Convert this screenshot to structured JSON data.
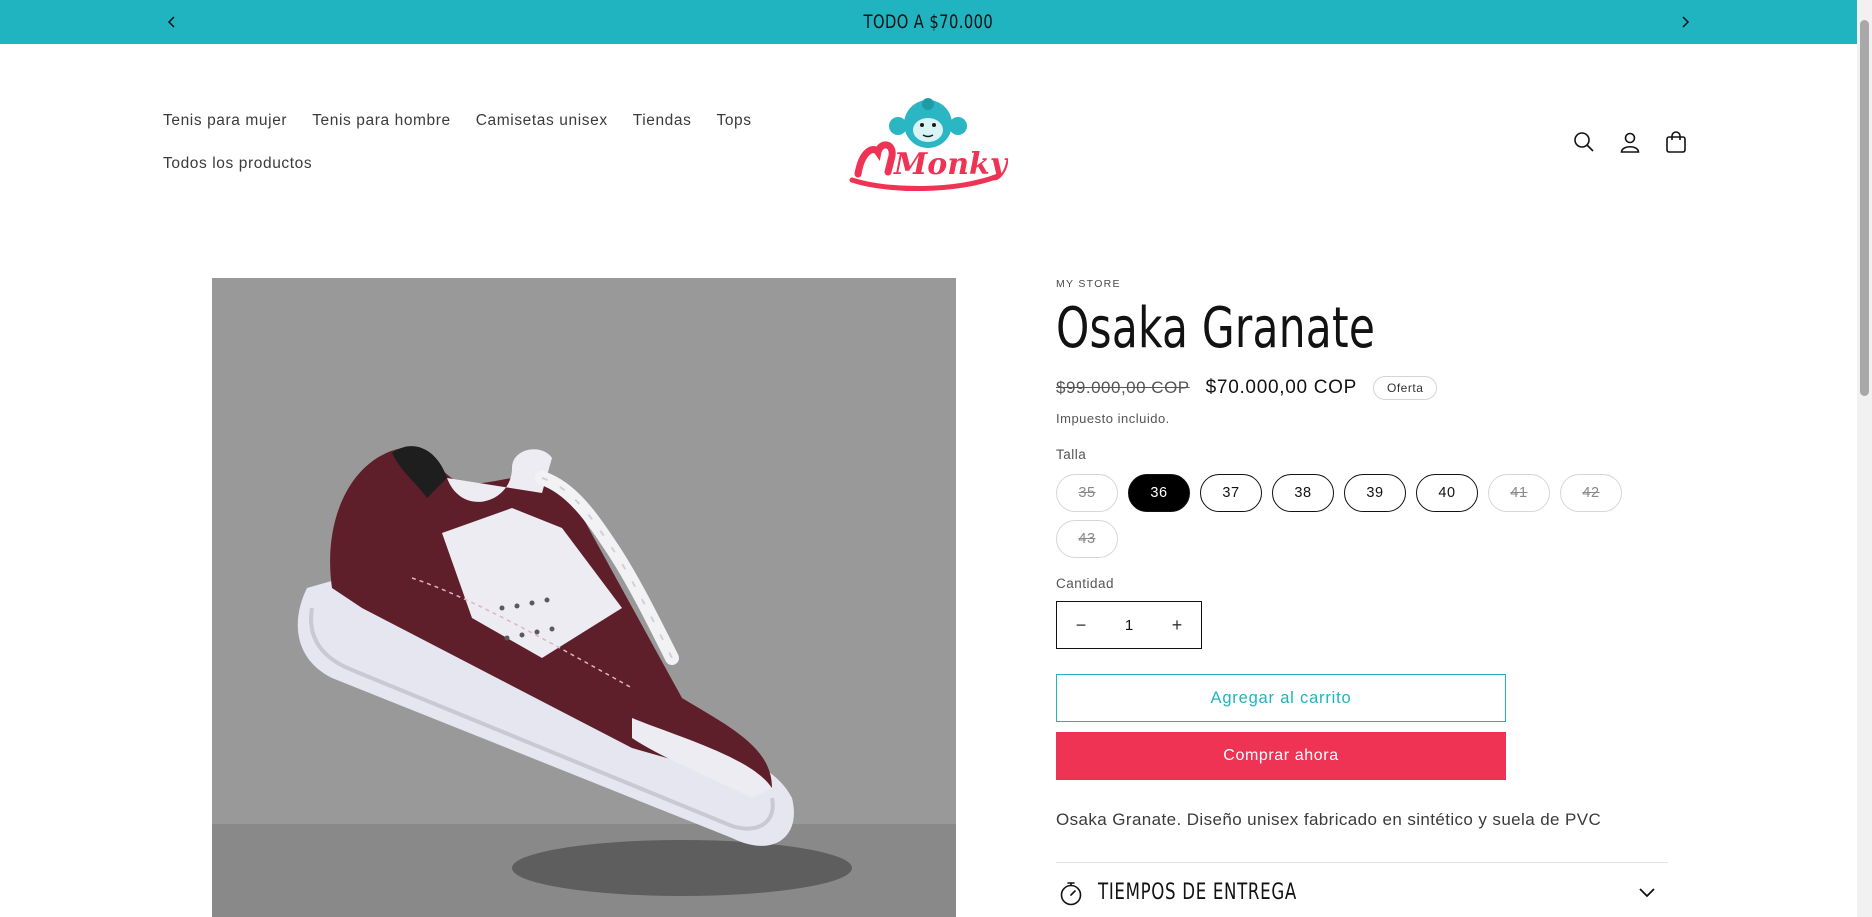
{
  "announcement": {
    "text": "TODO A $70.000",
    "prev_icon": "chevron-left-icon",
    "next_icon": "chevron-right-icon",
    "background": "#20b4c0"
  },
  "header": {
    "nav_rows": [
      [
        "Tenis para mujer",
        "Tenis para hombre",
        "Camisetas unisex",
        "Tiendas",
        "Tops"
      ],
      [
        "Todos los productos"
      ]
    ],
    "logo_text": "Monky",
    "icons": [
      "search-icon",
      "account-icon",
      "cart-icon"
    ]
  },
  "product": {
    "vendor": "MY STORE",
    "title": "Osaka Granate",
    "price_regular": "$99.000,00 COP",
    "price_sale": "$70.000,00 COP",
    "badge": "Oferta",
    "tax_note": "Impuesto incluido.",
    "size_label": "Talla",
    "sizes": [
      {
        "label": "35",
        "state": "disabled"
      },
      {
        "label": "36",
        "state": "selected"
      },
      {
        "label": "37",
        "state": "available"
      },
      {
        "label": "38",
        "state": "available"
      },
      {
        "label": "39",
        "state": "available"
      },
      {
        "label": "40",
        "state": "available"
      },
      {
        "label": "41",
        "state": "disabled"
      },
      {
        "label": "42",
        "state": "disabled"
      },
      {
        "label": "43",
        "state": "disabled"
      }
    ],
    "quantity_label": "Cantidad",
    "quantity": "1",
    "minus": "−",
    "plus": "+",
    "add_to_cart": "Agregar al carrito",
    "buy_now": "Comprar ahora",
    "description": "Osaka Granate. Diseño unisex fabricado en sintético y suela de PVC",
    "accordion": {
      "title": "TIEMPOS DE ENTREGA",
      "icon": "stopwatch-icon"
    }
  },
  "colors": {
    "accent": "#20b4c0",
    "buy_button": "#ef3354",
    "shoe_primary": "#5e1f2a"
  }
}
